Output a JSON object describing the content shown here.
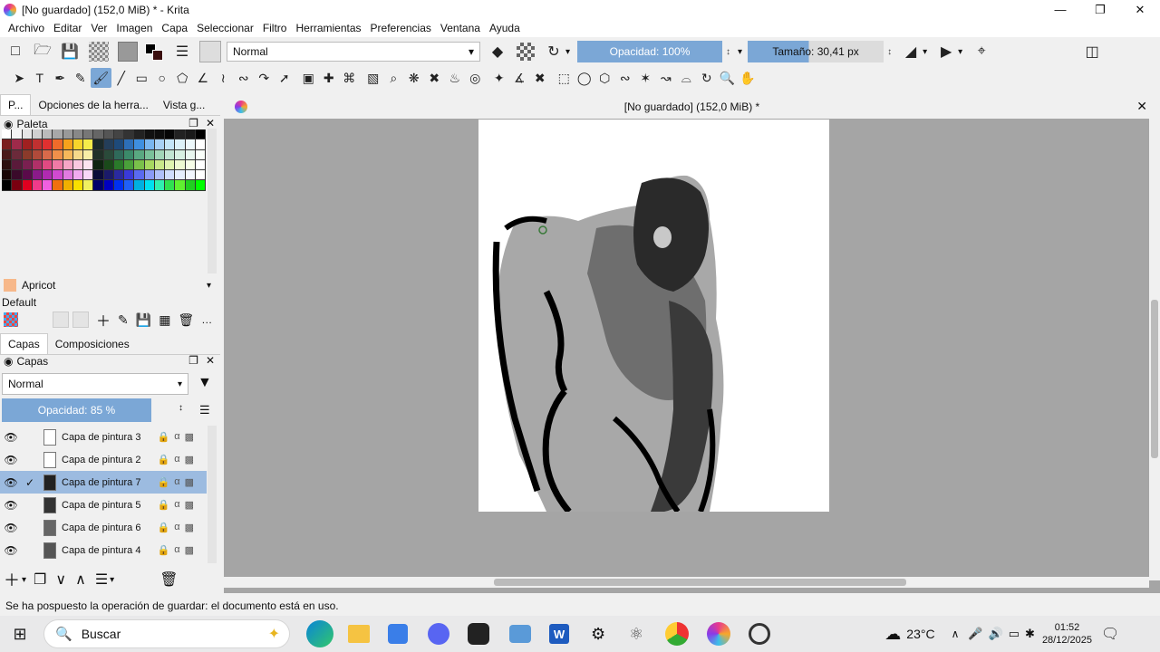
{
  "window": {
    "title": "[No guardado]  (152,0 MiB) * - Krita"
  },
  "menu": [
    "Archivo",
    "Editar",
    "Ver",
    "Imagen",
    "Capa",
    "Seleccionar",
    "Filtro",
    "Herramientas",
    "Preferencias",
    "Ventana",
    "Ayuda"
  ],
  "toolbar": {
    "blend_mode": "Normal",
    "opacity": "Opacidad: 100%",
    "size": "Tamaño: 30,41 px"
  },
  "left_tabs": [
    "P...",
    "Opciones de la herra...",
    "Vista g..."
  ],
  "palette": {
    "title": "Paleta",
    "current_color_name": "Apricot",
    "current_color": "#f7b88a",
    "set_name": "Default"
  },
  "layers_tabs": [
    "Capas",
    "Composiciones"
  ],
  "layers": {
    "title": "Capas",
    "blend_mode": "Normal",
    "opacity": "Opacidad: 85 %",
    "items": [
      {
        "name": "Capa de pintura 3"
      },
      {
        "name": "Capa de pintura 2"
      },
      {
        "name": "Capa de pintura 7",
        "selected": true
      },
      {
        "name": "Capa de pintura 5"
      },
      {
        "name": "Capa de pintura 6"
      },
      {
        "name": "Capa de pintura 4"
      }
    ]
  },
  "document": {
    "tab_title": "[No guardado]  (152,0 MiB) *"
  },
  "status": "Se ha pospuesto la operación de guardar: el documento está en uso.",
  "taskbar": {
    "search": "Buscar",
    "weather": "23°C",
    "time": "01:52",
    "date": "28/12/2025"
  }
}
